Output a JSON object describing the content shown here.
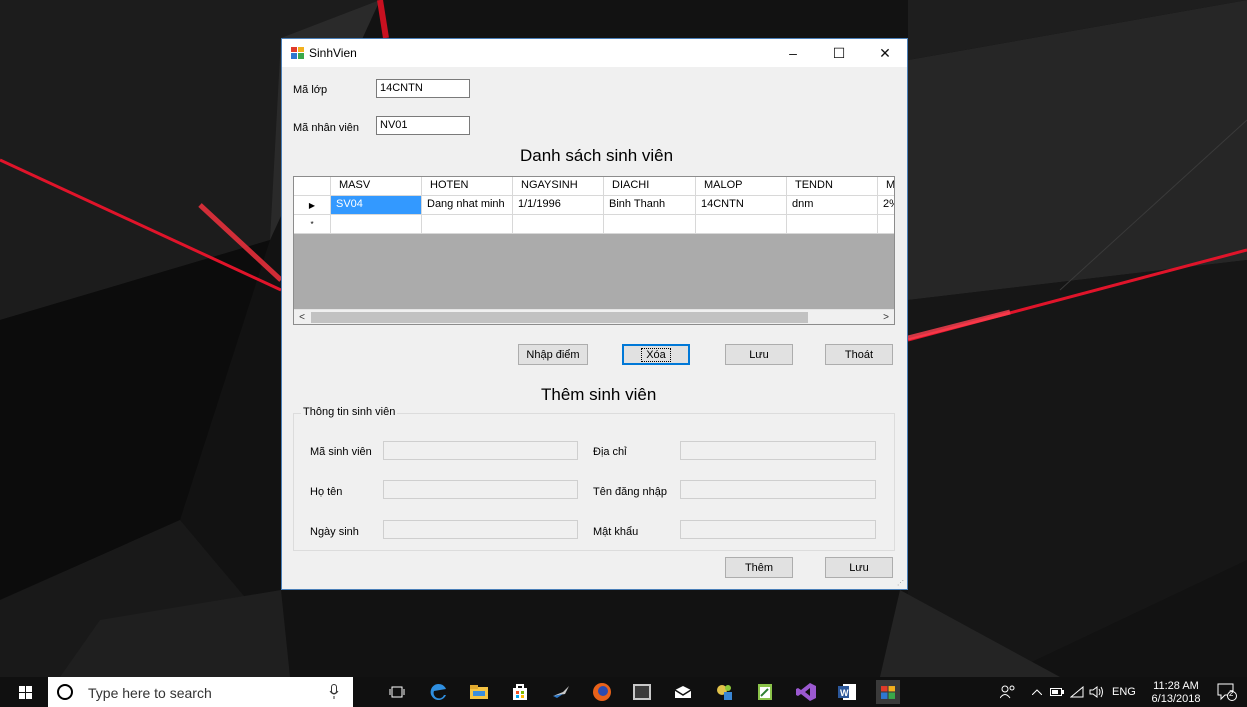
{
  "window": {
    "title": "SinhVien",
    "controls": {
      "minimize": "–",
      "maximize": "☐",
      "close": "✕"
    }
  },
  "filters": {
    "class_label": "Mã lớp",
    "class_value": "14CNTN",
    "staff_label": "Mã nhân viên",
    "staff_value": "NV01"
  },
  "list_heading": "Danh sách sinh viên",
  "grid": {
    "columns": [
      "MASV",
      "HOTEN",
      "NGAYSINH",
      "DIACHI",
      "MALOP",
      "TENDN",
      "M"
    ],
    "rows": [
      [
        "SV04",
        "Dang nhat minh",
        "1/1/1996",
        "Binh Thanh",
        "14CNTN",
        "dnm",
        "2%"
      ]
    ],
    "current_row_marker": "▶",
    "new_row_marker": "*",
    "scroll_left": "<",
    "scroll_right": ">"
  },
  "actions": {
    "enter_grades": "Nhập điểm",
    "delete": "Xóa",
    "save": "Lưu",
    "exit": "Thoát"
  },
  "add_heading": "Thêm sinh viên",
  "student_info": {
    "legend": "Thông tin sinh viên",
    "student_id_label": "Mã sinh viên",
    "name_label": "Họ tên",
    "dob_label": "Ngày sinh",
    "address_label": "Địa chỉ",
    "username_label": "Tên đăng nhập",
    "password_label": "Mật khẩu",
    "student_id_value": "",
    "name_value": "",
    "dob_value": "",
    "address_value": "",
    "username_value": "",
    "password_value": ""
  },
  "bottom_actions": {
    "add": "Thêm",
    "save": "Lưu"
  },
  "taskbar": {
    "search_placeholder": "Type here to search",
    "language": "ENG",
    "time": "11:28 AM",
    "date": "6/13/2018",
    "notification_count": "2",
    "app_icons": [
      "task-view-icon",
      "edge-icon",
      "file-explorer-icon",
      "store-icon",
      "sql-icon",
      "firefox-icon",
      "app-icon",
      "mail-icon",
      "paint-icon",
      "notepad-icon",
      "visual-studio-icon",
      "word-icon",
      "winforms-app-icon"
    ]
  },
  "colors": {
    "selection": "#3399ff",
    "accent": "#0078d7",
    "wallpaper_red": "#e0142a"
  }
}
